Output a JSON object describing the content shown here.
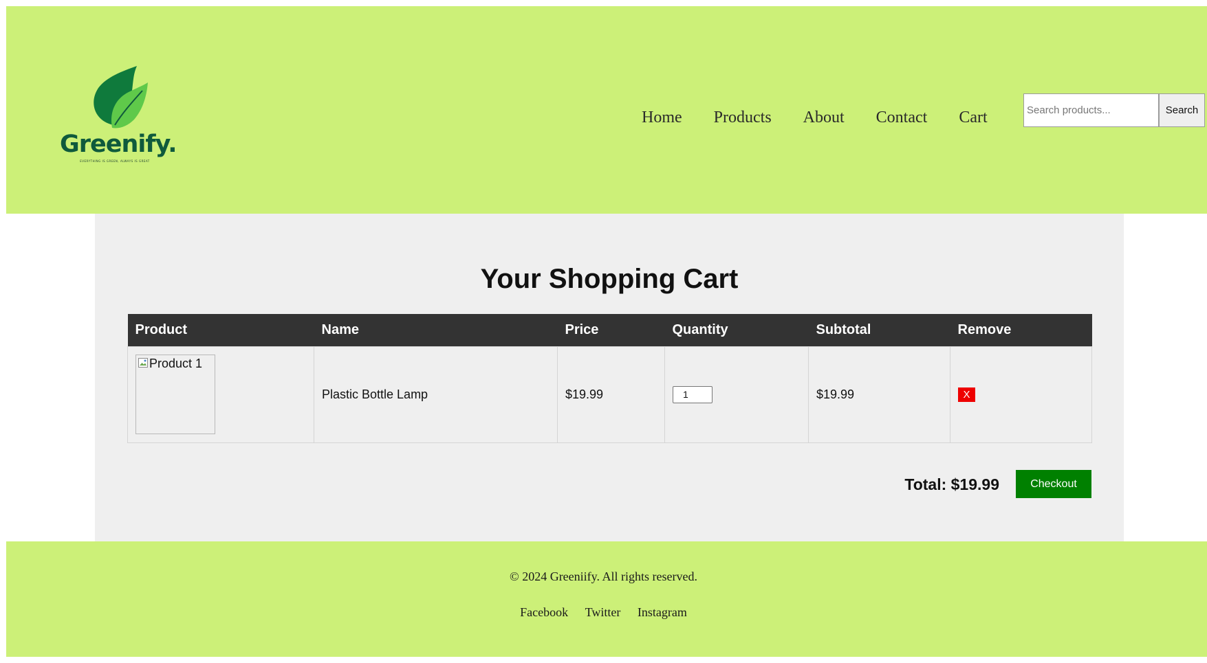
{
  "brand": {
    "name": "Greenify.",
    "tagline": "EVERYTHING IS GREEN, ALWAYS IS GREAT",
    "colors": {
      "leaf_dark": "#0f7a3c",
      "leaf_light": "#5fc94a",
      "wordmark": "#0f5a3c",
      "header_background": "#ccf078"
    }
  },
  "nav": {
    "items": [
      {
        "label": "Home"
      },
      {
        "label": "Products"
      },
      {
        "label": "About"
      },
      {
        "label": "Contact"
      },
      {
        "label": "Cart"
      }
    ]
  },
  "search": {
    "placeholder": "Search products...",
    "value": "",
    "button_label": "Search"
  },
  "cart": {
    "title": "Your Shopping Cart",
    "columns": [
      "Product",
      "Name",
      "Price",
      "Quantity",
      "Subtotal",
      "Remove"
    ],
    "items": [
      {
        "image_alt": "Product 1",
        "image_icon": "broken-image-icon",
        "name": "Plastic Bottle Lamp",
        "price": "$19.99",
        "quantity": "1",
        "subtotal": "$19.99",
        "remove_label": "X"
      }
    ],
    "total_label": "Total: $19.99",
    "checkout_label": "Checkout",
    "colors": {
      "header_background": "#333333",
      "remove_button": "#ee0000",
      "checkout_button": "#008000"
    }
  },
  "footer": {
    "copyright": "© 2024 Greeniify. All rights reserved.",
    "social": [
      {
        "label": "Facebook"
      },
      {
        "label": "Twitter"
      },
      {
        "label": "Instagram"
      }
    ]
  }
}
